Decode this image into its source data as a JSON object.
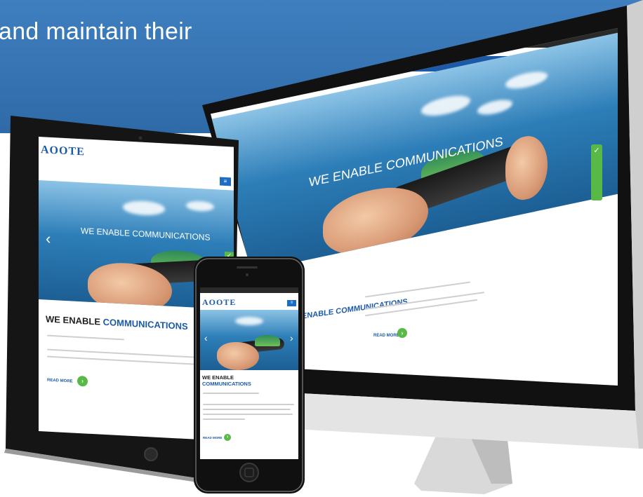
{
  "banner": {
    "headline": "and maintain their"
  },
  "brand": {
    "logo_text": "AOOTE",
    "accent_color": "#1c5aa7",
    "green_color": "#58b947"
  },
  "monitor": {
    "hero_tagline": "WE ENABLE COMMUNICATIONS",
    "section_heading": "ENABLE COMMUNICATIONS",
    "read_more": "READ MORE",
    "side_tab_icon": "check-icon"
  },
  "tablet": {
    "hero_tagline": "WE ENABLE COMMUNICATIONS",
    "section_heading_a": "WE ENABLE ",
    "section_heading_b": "COMMUNICATIONS",
    "read_more": "READ MORE",
    "prev_arrow": "‹"
  },
  "phone": {
    "section_heading_a": "WE ENABLE",
    "section_heading_b": "COMMUNICATIONS",
    "read_more": "READ MORE",
    "prev_arrow": "‹",
    "next_arrow": "›"
  }
}
